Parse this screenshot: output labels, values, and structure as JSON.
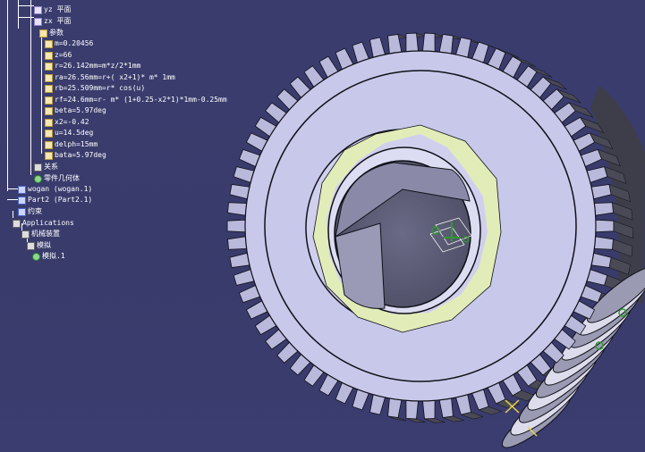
{
  "tree": {
    "items": [
      {
        "label": "yz 平面",
        "icon": "plane-icon"
      },
      {
        "label": "zx 平面",
        "icon": "plane-icon"
      },
      {
        "label": "参数",
        "icon": "parameters-icon"
      },
      {
        "label": "m=0.20456",
        "icon": "parameter-icon"
      },
      {
        "label": "z=66",
        "icon": "parameter-icon"
      },
      {
        "label": "r=26.142mm=m*z/2*1mm",
        "icon": "formula-icon"
      },
      {
        "label": "ra=26.56mm=r+( x2+1)* m* 1mm",
        "icon": "formula-icon"
      },
      {
        "label": "rb=25.509mm=r* cos(u)",
        "icon": "formula-icon"
      },
      {
        "label": "rf=24.6mm=r- m* (1+0.25-x2*1)*1mm-0.25mm",
        "icon": "formula-icon"
      },
      {
        "label": "beta=5.97deg",
        "icon": "parameter-icon"
      },
      {
        "label": "x2=-0.42",
        "icon": "parameter-icon"
      },
      {
        "label": "u=14.5deg",
        "icon": "parameter-icon"
      },
      {
        "label": "delph=15mm",
        "icon": "parameter-icon"
      },
      {
        "label": "bata=5.97deg",
        "icon": "parameter-icon"
      },
      {
        "label": "关系",
        "icon": "relations-icon"
      },
      {
        "label": "零件几何体",
        "icon": "body-icon"
      },
      {
        "label": "wogan (wogan.1)",
        "icon": "part-icon"
      },
      {
        "label": "Part2 (Part2.1)",
        "icon": "part-icon"
      },
      {
        "label": "约束",
        "icon": "constraints-icon"
      },
      {
        "label": "Applications",
        "icon": "applications-icon"
      },
      {
        "label": "机械装置",
        "icon": "mechanism-icon"
      },
      {
        "label": "模拟",
        "icon": "simulation-icon"
      },
      {
        "label": "模拟.1",
        "icon": "simulation-item-icon"
      }
    ]
  },
  "colors": {
    "background": "#3a3c6e",
    "gear_face": "#c8c8ea",
    "gear_teeth": "#b9b9dc",
    "gear_side": "#4a4a56",
    "bore": "#5e5e78",
    "hub_highlight": "#e2ecb8",
    "worm": "#dcdcec",
    "edge": "#101018",
    "axis_green": "#2e9a2e",
    "axis_yellow": "#e8d44a"
  }
}
